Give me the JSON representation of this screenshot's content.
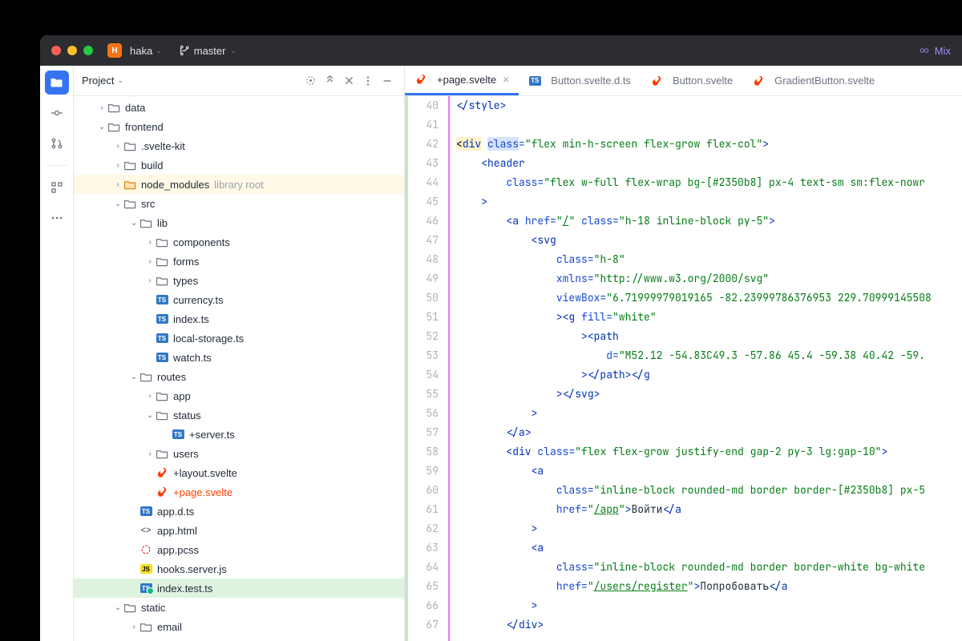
{
  "titlebar": {
    "project": "haka",
    "badge": "H",
    "branch": "master",
    "right": "Mix"
  },
  "sidebar": {
    "title": "Project",
    "actions": [
      "target",
      "collapse",
      "expand",
      "more",
      "minimize"
    ]
  },
  "tree": [
    {
      "d": 1,
      "chev": ">",
      "icon": "folder",
      "name": "data"
    },
    {
      "d": 1,
      "chev": "v",
      "icon": "folder",
      "name": "frontend"
    },
    {
      "d": 2,
      "chev": ">",
      "icon": "folder",
      "name": ".svelte-kit"
    },
    {
      "d": 2,
      "chev": ">",
      "icon": "folder",
      "name": "build"
    },
    {
      "d": 2,
      "chev": ">",
      "icon": "folder-lib",
      "name": "node_modules",
      "extra": "library root",
      "lib": true
    },
    {
      "d": 2,
      "chev": "v",
      "icon": "folder",
      "name": "src"
    },
    {
      "d": 3,
      "chev": "v",
      "icon": "folder",
      "name": "lib"
    },
    {
      "d": 4,
      "chev": ">",
      "icon": "folder",
      "name": "components"
    },
    {
      "d": 4,
      "chev": ">",
      "icon": "folder",
      "name": "forms"
    },
    {
      "d": 4,
      "chev": ">",
      "icon": "folder",
      "name": "types"
    },
    {
      "d": 4,
      "chev": "",
      "icon": "ts",
      "name": "currency.ts"
    },
    {
      "d": 4,
      "chev": "",
      "icon": "ts",
      "name": "index.ts"
    },
    {
      "d": 4,
      "chev": "",
      "icon": "ts",
      "name": "local-storage.ts"
    },
    {
      "d": 4,
      "chev": "",
      "icon": "ts",
      "name": "watch.ts"
    },
    {
      "d": 3,
      "chev": "v",
      "icon": "folder",
      "name": "routes"
    },
    {
      "d": 4,
      "chev": ">",
      "icon": "folder",
      "name": "app"
    },
    {
      "d": 4,
      "chev": "v",
      "icon": "folder",
      "name": "status"
    },
    {
      "d": 5,
      "chev": "",
      "icon": "ts",
      "name": "+server.ts"
    },
    {
      "d": 4,
      "chev": ">",
      "icon": "folder",
      "name": "users"
    },
    {
      "d": 4,
      "chev": "",
      "icon": "svelte",
      "name": "+layout.svelte"
    },
    {
      "d": 4,
      "chev": "",
      "icon": "svelte",
      "name": "+page.svelte",
      "selName": true
    },
    {
      "d": 3,
      "chev": "",
      "icon": "ts",
      "name": "app.d.ts"
    },
    {
      "d": 3,
      "chev": "",
      "icon": "html",
      "name": "app.html"
    },
    {
      "d": 3,
      "chev": "",
      "icon": "pcss",
      "name": "app.pcss"
    },
    {
      "d": 3,
      "chev": "",
      "icon": "js",
      "name": "hooks.server.js"
    },
    {
      "d": 3,
      "chev": "",
      "icon": "ts-test",
      "name": "index.test.ts",
      "sel": true
    },
    {
      "d": 2,
      "chev": "v",
      "icon": "folder",
      "name": "static"
    },
    {
      "d": 3,
      "chev": ">",
      "icon": "folder",
      "name": "email"
    }
  ],
  "tabs": [
    {
      "icon": "svelte",
      "label": "+page.svelte",
      "active": true,
      "close": true
    },
    {
      "icon": "ts",
      "label": "Button.svelte.d.ts"
    },
    {
      "icon": "svelte",
      "label": "Button.svelte"
    },
    {
      "icon": "svelte",
      "label": "GradientButton.svelte"
    }
  ],
  "code": {
    "start": 40,
    "lines": [
      [
        [
          "tag",
          "</"
        ],
        [
          "tag",
          "style"
        ],
        [
          "tag",
          ">"
        ]
      ],
      [],
      [
        [
          "hl-y",
          "<"
        ],
        [
          "hl-y tag",
          "div"
        ],
        [
          "plain",
          " "
        ],
        [
          "hl-b attr",
          "class"
        ],
        [
          "attr",
          "="
        ],
        [
          "str",
          "\"flex min-h-screen flex-grow flex-col\""
        ],
        [
          "tag",
          ">"
        ]
      ],
      [
        [
          "plain",
          "    "
        ],
        [
          "tag",
          "<header"
        ]
      ],
      [
        [
          "plain",
          "        "
        ],
        [
          "attr",
          "class"
        ],
        [
          "attr",
          "="
        ],
        [
          "str",
          "\"flex w-full flex-wrap bg-[#2350b8] px-4 text-sm sm:flex-nowr"
        ]
      ],
      [
        [
          "plain",
          "    "
        ],
        [
          "tag",
          ">"
        ]
      ],
      [
        [
          "plain",
          "        "
        ],
        [
          "tag",
          "<a "
        ],
        [
          "attr",
          "href"
        ],
        [
          "attr",
          "="
        ],
        [
          "str",
          "\""
        ],
        [
          "str u",
          "/"
        ],
        [
          "str",
          "\""
        ],
        [
          "plain",
          " "
        ],
        [
          "attr",
          "class"
        ],
        [
          "attr",
          "="
        ],
        [
          "str",
          "\"h-18 inline-block py-5\""
        ],
        [
          "tag",
          ">"
        ]
      ],
      [
        [
          "plain",
          "            "
        ],
        [
          "tag",
          "<svg"
        ]
      ],
      [
        [
          "plain",
          "                "
        ],
        [
          "attr",
          "class"
        ],
        [
          "attr",
          "="
        ],
        [
          "str",
          "\"h-8\""
        ]
      ],
      [
        [
          "plain",
          "                "
        ],
        [
          "attr",
          "xmlns"
        ],
        [
          "attr",
          "="
        ],
        [
          "str",
          "\"http://www.w3.org/2000/svg\""
        ]
      ],
      [
        [
          "plain",
          "                "
        ],
        [
          "attr",
          "viewBox"
        ],
        [
          "attr",
          "="
        ],
        [
          "str",
          "\"6.71999979019165 -82.23999786376953 229.70999145508"
        ]
      ],
      [
        [
          "plain",
          "                "
        ],
        [
          "tag",
          "><g "
        ],
        [
          "attr",
          "fill"
        ],
        [
          "attr",
          "="
        ],
        [
          "str",
          "\"white\""
        ]
      ],
      [
        [
          "plain",
          "                    "
        ],
        [
          "tag",
          "><path"
        ]
      ],
      [
        [
          "plain",
          "                        "
        ],
        [
          "attr",
          "d"
        ],
        [
          "attr",
          "="
        ],
        [
          "str",
          "\"M52.12 -54.83C49.3 -57.86 45.4 -59.38 40.42 -59."
        ]
      ],
      [
        [
          "plain",
          "                    "
        ],
        [
          "tag",
          "></"
        ],
        [
          "tag",
          "path"
        ],
        [
          "tag",
          "></"
        ],
        [
          "tag",
          "g"
        ]
      ],
      [
        [
          "plain",
          "                "
        ],
        [
          "tag",
          "></"
        ],
        [
          "tag",
          "svg"
        ],
        [
          "tag",
          ">"
        ]
      ],
      [
        [
          "plain",
          "            "
        ],
        [
          "tag",
          ">"
        ]
      ],
      [
        [
          "plain",
          "        "
        ],
        [
          "tag",
          "</"
        ],
        [
          "tag",
          "a"
        ],
        [
          "tag",
          ">"
        ]
      ],
      [
        [
          "plain",
          "        "
        ],
        [
          "tag",
          "<div "
        ],
        [
          "attr",
          "class"
        ],
        [
          "attr",
          "="
        ],
        [
          "str",
          "\"flex flex-grow justify-end gap-2 py-3 lg:gap-10\""
        ],
        [
          "tag",
          ">"
        ]
      ],
      [
        [
          "plain",
          "            "
        ],
        [
          "tag",
          "<a"
        ]
      ],
      [
        [
          "plain",
          "                "
        ],
        [
          "attr",
          "class"
        ],
        [
          "attr",
          "="
        ],
        [
          "str",
          "\"inline-block rounded-md border border-[#2350b8] px-5"
        ]
      ],
      [
        [
          "plain",
          "                "
        ],
        [
          "attr",
          "href"
        ],
        [
          "attr",
          "="
        ],
        [
          "str",
          "\""
        ],
        [
          "str u",
          "/app"
        ],
        [
          "str",
          "\""
        ],
        [
          "tag",
          ">"
        ],
        [
          "txt",
          "Войти"
        ],
        [
          "tag",
          "</"
        ],
        [
          "tag",
          "a"
        ]
      ],
      [
        [
          "plain",
          "            "
        ],
        [
          "tag",
          ">"
        ]
      ],
      [
        [
          "plain",
          "            "
        ],
        [
          "tag",
          "<a"
        ]
      ],
      [
        [
          "plain",
          "                "
        ],
        [
          "attr",
          "class"
        ],
        [
          "attr",
          "="
        ],
        [
          "str",
          "\"inline-block rounded-md border border-white bg-white"
        ]
      ],
      [
        [
          "plain",
          "                "
        ],
        [
          "attr",
          "href"
        ],
        [
          "attr",
          "="
        ],
        [
          "str",
          "\""
        ],
        [
          "str u",
          "/users/register"
        ],
        [
          "str",
          "\""
        ],
        [
          "tag",
          ">"
        ],
        [
          "txt",
          "Попробовать"
        ],
        [
          "tag",
          "</"
        ],
        [
          "tag",
          "a"
        ]
      ],
      [
        [
          "plain",
          "            "
        ],
        [
          "tag",
          ">"
        ]
      ],
      [
        [
          "plain",
          "        "
        ],
        [
          "tag",
          "</"
        ],
        [
          "tag",
          "div"
        ],
        [
          "tag",
          ">"
        ]
      ]
    ]
  }
}
